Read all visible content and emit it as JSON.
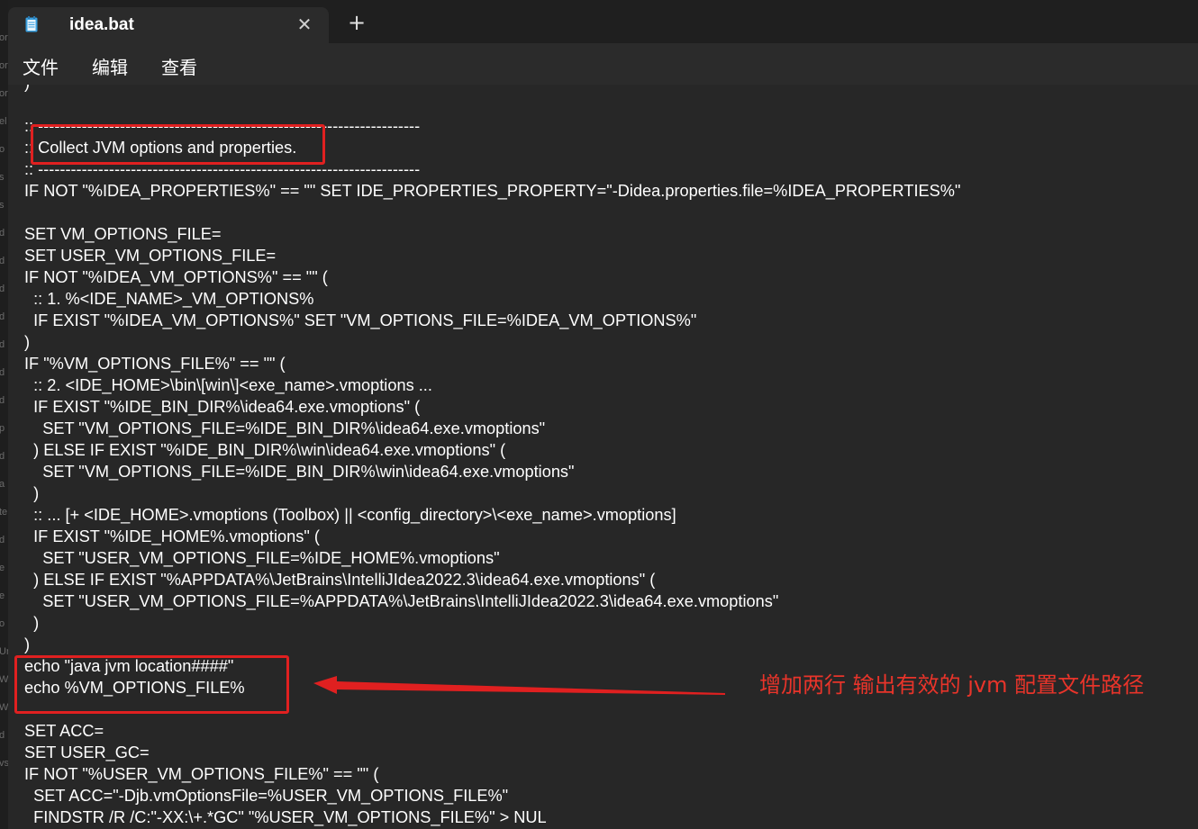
{
  "window": {
    "tab_title": "idea.bat",
    "close_glyph": "✕",
    "new_tab_glyph": "+"
  },
  "menu": [
    "文件",
    "编辑",
    "查看"
  ],
  "code_lines": [
    ")",
    "",
    ":: ----------------------------------------------------------------------",
    ":: Collect JVM options and properties.",
    ":: ----------------------------------------------------------------------",
    "IF NOT \"%IDEA_PROPERTIES%\" == \"\" SET IDE_PROPERTIES_PROPERTY=\"-Didea.properties.file=%IDEA_PROPERTIES%\"",
    "",
    "SET VM_OPTIONS_FILE=",
    "SET USER_VM_OPTIONS_FILE=",
    "IF NOT \"%IDEA_VM_OPTIONS%\" == \"\" (",
    "  :: 1. %<IDE_NAME>_VM_OPTIONS%",
    "  IF EXIST \"%IDEA_VM_OPTIONS%\" SET \"VM_OPTIONS_FILE=%IDEA_VM_OPTIONS%\"",
    ")",
    "IF \"%VM_OPTIONS_FILE%\" == \"\" (",
    "  :: 2. <IDE_HOME>\\bin\\[win\\]<exe_name>.vmoptions ...",
    "  IF EXIST \"%IDE_BIN_DIR%\\idea64.exe.vmoptions\" (",
    "    SET \"VM_OPTIONS_FILE=%IDE_BIN_DIR%\\idea64.exe.vmoptions\"",
    "  ) ELSE IF EXIST \"%IDE_BIN_DIR%\\win\\idea64.exe.vmoptions\" (",
    "    SET \"VM_OPTIONS_FILE=%IDE_BIN_DIR%\\win\\idea64.exe.vmoptions\"",
    "  )",
    "  :: ... [+ <IDE_HOME>.vmoptions (Toolbox) || <config_directory>\\<exe_name>.vmoptions]",
    "  IF EXIST \"%IDE_HOME%.vmoptions\" (",
    "    SET \"USER_VM_OPTIONS_FILE=%IDE_HOME%.vmoptions\"",
    "  ) ELSE IF EXIST \"%APPDATA%\\JetBrains\\IntelliJIdea2022.3\\idea64.exe.vmoptions\" (",
    "    SET \"USER_VM_OPTIONS_FILE=%APPDATA%\\JetBrains\\IntelliJIdea2022.3\\idea64.exe.vmoptions\"",
    "  )",
    ")",
    "echo \"java jvm location####\"",
    "echo %VM_OPTIONS_FILE%",
    "",
    "SET ACC=",
    "SET USER_GC=",
    "IF NOT \"%USER_VM_OPTIONS_FILE%\" == \"\" (",
    "  SET ACC=\"-Djb.vmOptionsFile=%USER_VM_OPTIONS_FILE%\"",
    "  FINDSTR /R /C:\"-XX:\\+.*GC\" \"%USER_VM_OPTIONS_FILE%\" > NUL"
  ],
  "annotation": {
    "text": "增加两行 输出有效的 jvm 配置文件路径",
    "color": "#e02020"
  },
  "background_window_fragments": [
    "or",
    "or",
    "or",
    "el",
    "o",
    "s",
    "s",
    "d",
    "d",
    "d",
    "d",
    "d",
    "d",
    "d",
    "p",
    "d",
    "a",
    "te",
    "d",
    "e",
    "e",
    "o",
    "Ur",
    "W",
    "W",
    "d",
    "vs"
  ]
}
